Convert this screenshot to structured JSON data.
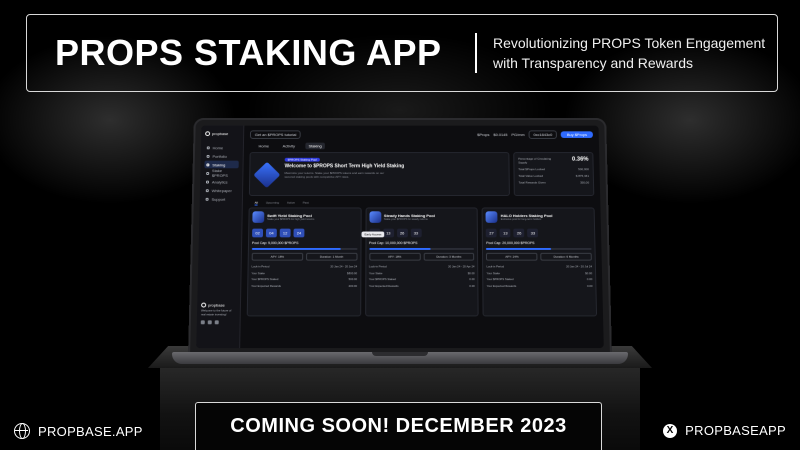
{
  "banner": {
    "title": "PROPS STAKING APP",
    "subtitle_line1": "Revolutionizing PROPS Token Engagement",
    "subtitle_line2": "with Transparency and Rewards"
  },
  "app": {
    "logo": "propbase",
    "sidebar": {
      "items": [
        "Home",
        "Portfolio",
        "Staking",
        "Stake $PROPS",
        "Analytics",
        "Whitepaper",
        "Support"
      ],
      "active_index": 2,
      "footer_line1": "propbase",
      "footer_line2": "Welcome to the future of real estate investing!"
    },
    "topbar": {
      "back_label": "Get an $PROPS tutorial",
      "chips": [
        "$Props",
        "$0.0145",
        "PG/mm"
      ],
      "address": "0xc1843c0",
      "connect_label": "Buy $Props"
    },
    "tabs": [
      "Home",
      "Activity",
      "Staking"
    ],
    "hero": {
      "pill": "$PROPS Staking Pool",
      "title": "Welcome to $PROPS Short Term High Yield Staking",
      "desc": "Maximize your returns. Stake your $PROPS tokens and earn rewards on our secured staking pools with competitive APY rates.",
      "stats": [
        {
          "label": "Percentage of Circulating Supply",
          "value": "0.36%"
        },
        {
          "label": "Total $Props Locked",
          "value": "500,300"
        },
        {
          "label": "Total Value Locked",
          "value": "$ 875,441"
        },
        {
          "label": "Total Rewards Given",
          "value": "350,00"
        }
      ]
    },
    "sub_tabs": [
      "All",
      "Upcoming",
      "Active",
      "Past"
    ],
    "tooltip": "Early Access",
    "pools": [
      {
        "title": "Swift Yield Staking Pool",
        "desc": "Stake your $PROPS for high yield returns",
        "countdown": [
          "02",
          "04",
          "12",
          "24"
        ],
        "cap": "Pool Cap: 5,000,000 $PROPS",
        "buttons": [
          "APY: 18%",
          "Duration: 1 Month"
        ],
        "rows": [
          {
            "k": "Lock-in Period",
            "v": "20 Jan 24 - 20 Jan 24"
          },
          {
            "k": "Your Stake",
            "v": "$800.00"
          },
          {
            "k": "Your $PROPS Staked",
            "v": "500.00"
          },
          {
            "k": "Your Expected Rewards",
            "v": "200.00"
          }
        ]
      },
      {
        "title": "Steady Hands Staking Pool",
        "desc": "Stake your $PROPS for steady returns",
        "countdown": [
          "27",
          "13",
          "26",
          "33"
        ],
        "cap": "Pool Cap: 10,000,000 $PROPS",
        "buttons": [
          "APY: 18%",
          "Duration: 3 Months"
        ],
        "rows": [
          {
            "k": "Lock-in Period",
            "v": "20 Jan 24 - 20 Apr 24"
          },
          {
            "k": "Your Stake",
            "v": "$0.00"
          },
          {
            "k": "Your $PROPS Staked",
            "v": "0.00"
          },
          {
            "k": "Your Expected Rewards",
            "v": "0.00"
          }
        ]
      },
      {
        "title": "HALO Holders Staking Pool",
        "desc": "Exclusive pool for long-term holders",
        "countdown": [
          "27",
          "13",
          "26",
          "33"
        ],
        "cap": "Pool Cap: 20,000,000 $PROPS",
        "buttons": [
          "APY: 24%",
          "Duration: 6 Months"
        ],
        "rows": [
          {
            "k": "Lock-in Period",
            "v": "20 Jan 24 - 20 Jul 24"
          },
          {
            "k": "Your Stake",
            "v": "$0.00"
          },
          {
            "k": "Your $PROPS Staked",
            "v": "0.00"
          },
          {
            "k": "Your Expected Rewards",
            "v": "0.00"
          }
        ]
      }
    ],
    "pool_fill_pct": [
      0.84,
      0.58,
      0.62
    ]
  },
  "footer": {
    "website": "PROPBASE.APP",
    "cta": "COMING SOON! DECEMBER 2023",
    "handle": "PROPBASEAPP",
    "website_icon": "globe-icon",
    "handle_icon": "x-icon"
  },
  "colors": {
    "accent": "#2f6bff",
    "background": "#000000",
    "text": "#ffffff"
  }
}
